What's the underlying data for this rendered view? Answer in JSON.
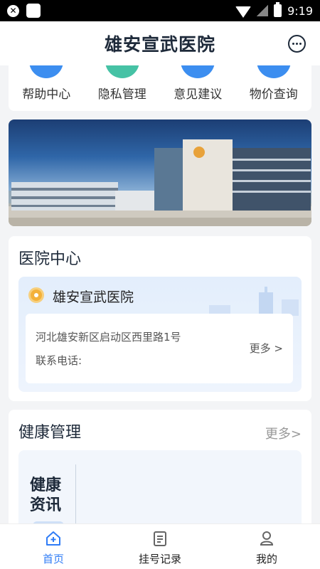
{
  "status_bar": {
    "time": "9:19"
  },
  "header": {
    "title": "雄安宣武医院"
  },
  "quick_menu": [
    {
      "label": "帮助中心",
      "icon": "help-icon",
      "color": "#3c8ef0"
    },
    {
      "label": "隐私管理",
      "icon": "privacy-icon",
      "color": "#46c2a5"
    },
    {
      "label": "意见建议",
      "icon": "feedback-icon",
      "color": "#3c8ef0"
    },
    {
      "label": "物价查询",
      "icon": "price-query-icon",
      "color": "#3c8ef0"
    }
  ],
  "hospital_center": {
    "title": "医院中心",
    "name": "雄安宣武医院",
    "address": "河北雄安新区启动区西里路1号",
    "phone_label": "联系电话:",
    "more": "更多 >"
  },
  "health_management": {
    "title": "健康管理",
    "more": "更多>",
    "tag": "健康资讯"
  },
  "bottom_nav": [
    {
      "label": "首页",
      "icon": "home-icon",
      "active": true
    },
    {
      "label": "挂号记录",
      "icon": "register-record-icon",
      "active": false
    },
    {
      "label": "我的",
      "icon": "profile-icon",
      "active": false
    }
  ],
  "colors": {
    "accent": "#2f7cf6",
    "title": "#1e2a3a",
    "muted": "#999999"
  }
}
